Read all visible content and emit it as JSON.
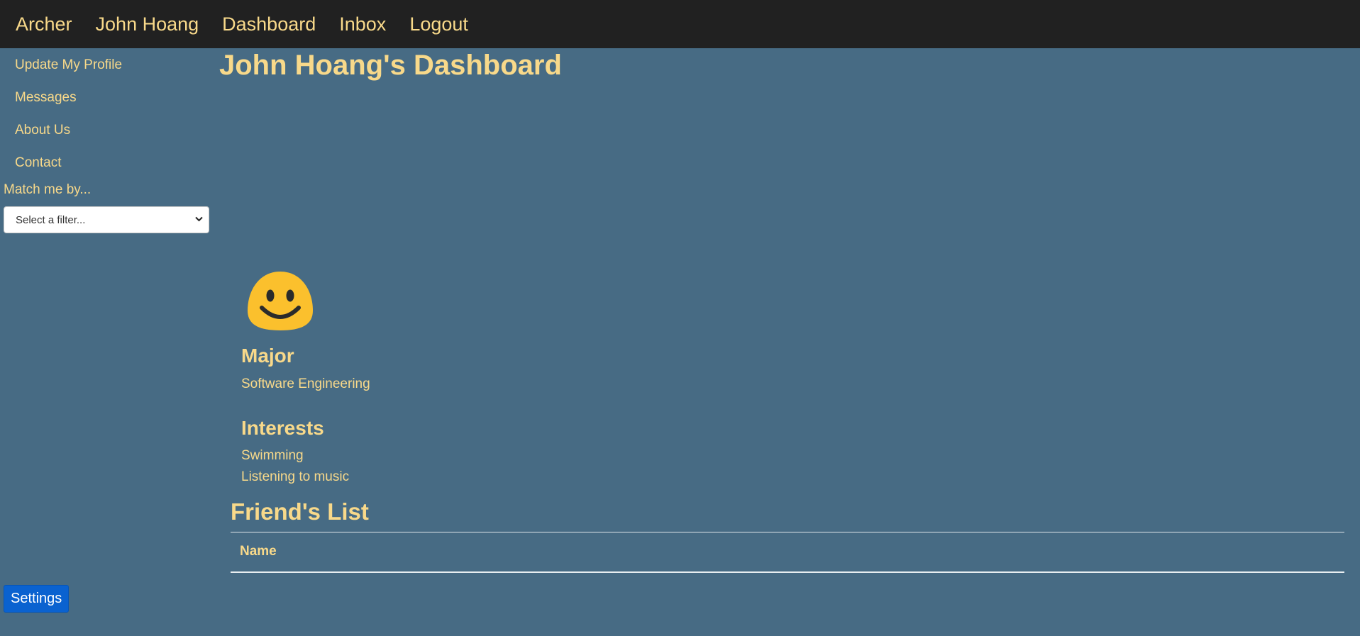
{
  "nav": {
    "brand": "Archer",
    "user": "John Hoang",
    "dashboard": "Dashboard",
    "inbox": "Inbox",
    "logout": "Logout"
  },
  "sidebar": {
    "items": [
      {
        "label": "Update My Profile"
      },
      {
        "label": "Messages"
      },
      {
        "label": "About Us"
      },
      {
        "label": "Contact"
      }
    ],
    "match_label": "Match me by...",
    "filter_selected": "Select a filter...",
    "settings_label": "Settings"
  },
  "main": {
    "title": "John Hoang's Dashboard",
    "avatar_icon": "smiley-face-icon",
    "major_heading": "Major",
    "major_value": "Software Engineering",
    "interests_heading": "Interests",
    "interests": [
      "Swimming",
      "Listening to music"
    ],
    "friends_title": "Friend's List",
    "friends_table": {
      "columns": [
        "Name"
      ],
      "rows": []
    }
  },
  "colors": {
    "background": "#476b84",
    "nav_background": "#212121",
    "text_accent": "#f8d98a",
    "button_primary": "#0a62d0"
  }
}
